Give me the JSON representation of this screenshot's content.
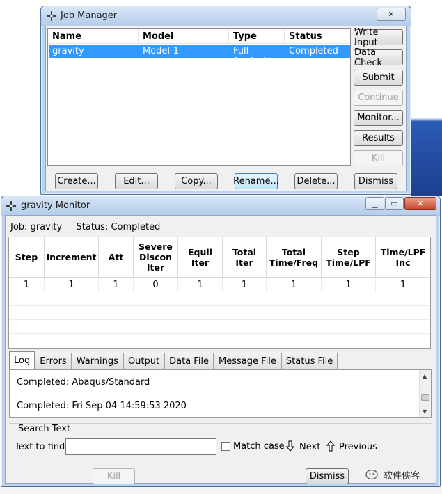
{
  "job_manager": {
    "title": "Job Manager",
    "columns": [
      "Name",
      "Model",
      "Type",
      "Status"
    ],
    "rows": [
      {
        "name": "gravity",
        "model": "Model-1",
        "type": "Full Analysis",
        "status": "Completed"
      }
    ],
    "side_buttons": {
      "write_input": "Write Input",
      "data_check": "Data Check",
      "submit": "Submit",
      "continue": "Continue",
      "monitor": "Monitor...",
      "results": "Results",
      "kill": "Kill"
    },
    "bottom_buttons": {
      "create": "Create...",
      "edit": "Edit...",
      "copy": "Copy...",
      "rename": "Rename...",
      "delete": "Delete...",
      "dismiss": "Dismiss"
    }
  },
  "monitor": {
    "title": "gravity Monitor",
    "job_label": "Job:",
    "job_value": "gravity",
    "status_label": "Status:",
    "status_value": "Completed",
    "columns": [
      "Step",
      "Increment",
      "Att",
      "Severe Discon Iter",
      "Equil Iter",
      "Total Iter",
      "Total Time/Freq",
      "Step Time/LPF",
      "Time/LPF Inc"
    ],
    "rows": [
      [
        "1",
        "1",
        "1",
        "0",
        "1",
        "1",
        "1",
        "1",
        "1"
      ]
    ],
    "tabs": [
      "Log",
      "Errors",
      "Warnings",
      "Output",
      "Data File",
      "Message File",
      "Status File"
    ],
    "active_tab": "Log",
    "log_lines": [
      "Completed: Abaqus/Standard",
      "Completed: Fri Sep 04 14:59:53 2020"
    ],
    "search": {
      "group_label": "Search Text",
      "find_label": "Text to find:",
      "find_value": "",
      "match_case_label": "Match case",
      "match_case_checked": false,
      "next_label": "Next",
      "previous_label": "Previous"
    },
    "kill_label": "Kill",
    "dismiss_label": "Dismiss"
  },
  "watermark": "软件侠客",
  "icons": {
    "app_icon": "abaqus-cross-icon",
    "next": "arrow-down-icon",
    "previous": "arrow-up-icon"
  }
}
